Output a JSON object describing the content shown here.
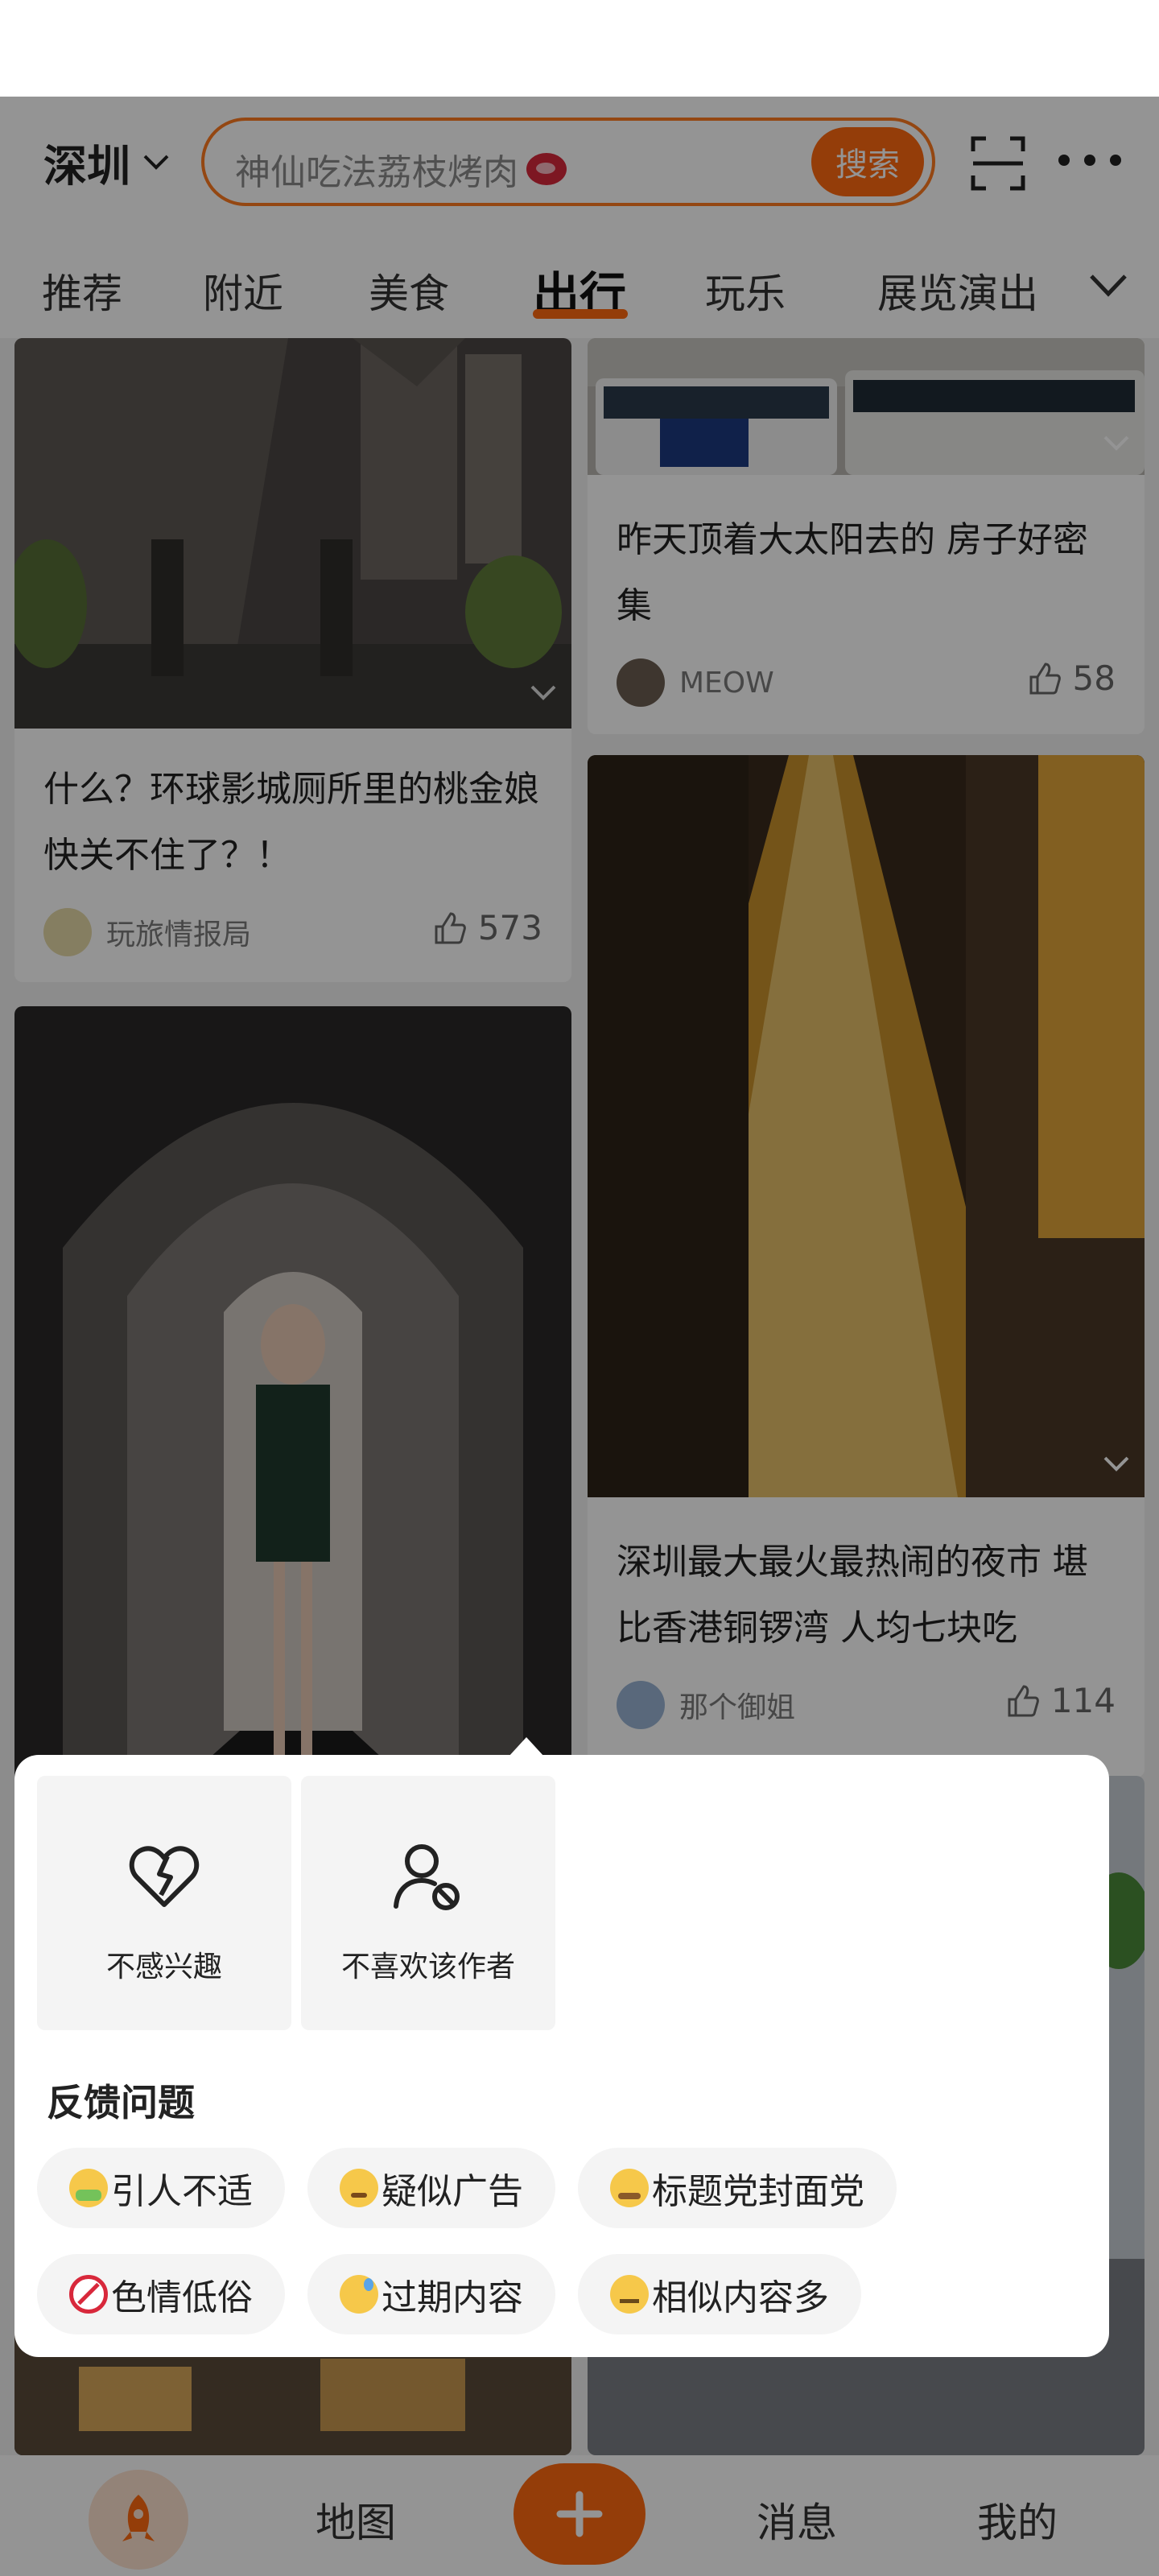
{
  "header": {
    "city": "深圳",
    "search_placeholder": "神仙吃法荔枝烤肉",
    "search_button": "搜索",
    "icons": [
      "chevron-down-icon",
      "meat-emoji-icon",
      "scan-icon",
      "more-icon"
    ]
  },
  "tabs": [
    {
      "label": "推荐",
      "active": false
    },
    {
      "label": "附近",
      "active": false
    },
    {
      "label": "美食",
      "active": false
    },
    {
      "label": "出行",
      "active": true
    },
    {
      "label": "玩乐",
      "active": false
    },
    {
      "label": "展览演出",
      "active": false
    }
  ],
  "feed": {
    "cards": [
      {
        "title": "什么？环球影城厕所里的桃金娘快关不住了？！",
        "author": "玩旅情报局",
        "likes": "573"
      },
      {
        "title": "昨天顶着大太阳去的  房子好密集",
        "author": "MEOW",
        "likes": "58"
      },
      {
        "title": "深圳最大最火最热闹的夜市 堪比香港铜锣湾 人均七块吃",
        "author": "那个御姐",
        "likes": "114"
      }
    ]
  },
  "popup": {
    "actions": [
      {
        "label": "不感兴趣",
        "icon": "broken-heart-icon"
      },
      {
        "label": "不喜欢该作者",
        "icon": "block-user-icon"
      }
    ],
    "feedback_title": "反馈问题",
    "chips": [
      {
        "label": "引人不适",
        "icon": "sick-emoji-icon"
      },
      {
        "label": "疑似广告",
        "icon": "thinking-emoji-icon"
      },
      {
        "label": "标题党封面党",
        "icon": "steam-emoji-icon"
      },
      {
        "label": "色情低俗",
        "icon": "no-under-18-icon"
      },
      {
        "label": "过期内容",
        "icon": "sweat-smile-emoji-icon"
      },
      {
        "label": "相似内容多",
        "icon": "neutral-face-emoji-icon"
      }
    ]
  },
  "bottom_nav": [
    {
      "label": "",
      "icon": "rocket-icon"
    },
    {
      "label": "地图"
    },
    {
      "label": "",
      "icon": "plus-icon"
    },
    {
      "label": "消息"
    },
    {
      "label": "我的"
    }
  ],
  "colors": {
    "accent": "#ff6a10",
    "overlay": "rgba(0,0,0,0.42)"
  }
}
